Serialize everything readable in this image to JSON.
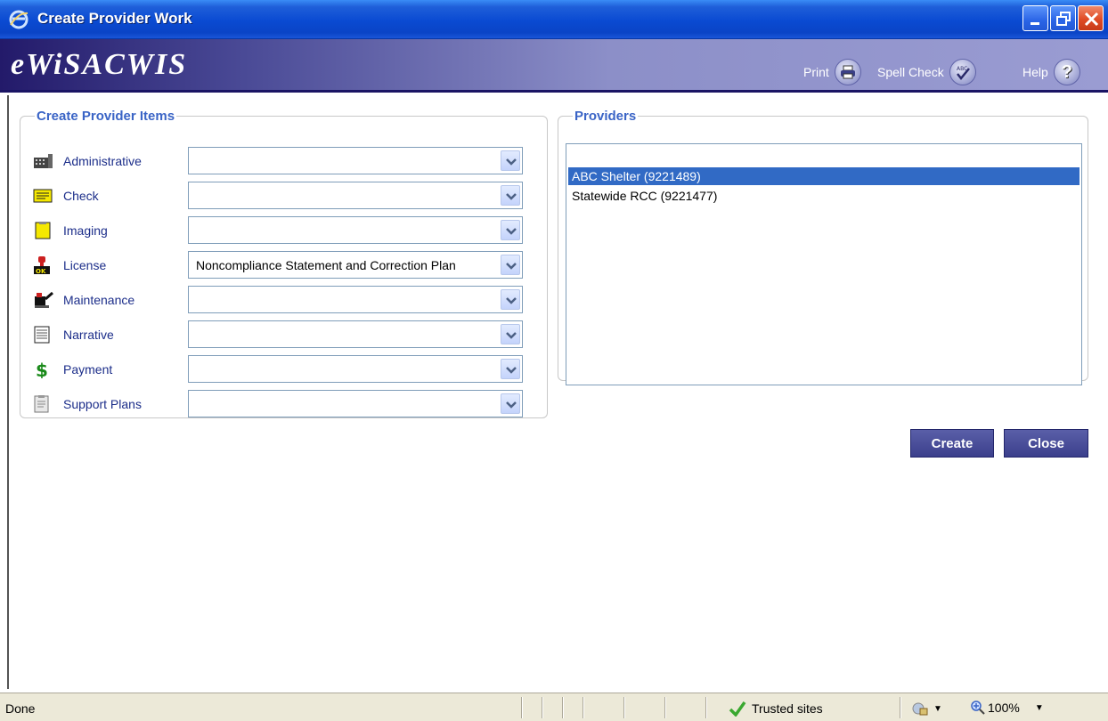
{
  "window": {
    "title": "Create Provider Work"
  },
  "banner": {
    "brand": "eWiSACWIS",
    "print_label": "Print",
    "spell_label": "Spell Check",
    "help_label": "Help"
  },
  "items_section": {
    "legend": "Create Provider Items",
    "items": [
      {
        "label": "Administrative",
        "value": "",
        "icon": "administrative-icon"
      },
      {
        "label": "Check",
        "value": "",
        "icon": "check-icon"
      },
      {
        "label": "Imaging",
        "value": "",
        "icon": "imaging-icon"
      },
      {
        "label": "License",
        "value": "Noncompliance Statement and Correction Plan",
        "icon": "license-icon"
      },
      {
        "label": "Maintenance",
        "value": "",
        "icon": "maintenance-icon"
      },
      {
        "label": "Narrative",
        "value": "",
        "icon": "narrative-icon"
      },
      {
        "label": "Payment",
        "value": "",
        "icon": "payment-icon"
      },
      {
        "label": "Support Plans",
        "value": "",
        "icon": "support-plans-icon"
      }
    ]
  },
  "providers_section": {
    "legend": "Providers",
    "providers": [
      {
        "label": "ABC Shelter (9221489)",
        "selected": true
      },
      {
        "label": "Statewide RCC (9221477)",
        "selected": false
      }
    ]
  },
  "buttons": {
    "create": "Create",
    "close": "Close"
  },
  "statusbar": {
    "status": "Done",
    "zone": "Trusted sites",
    "zoom": "100%"
  },
  "colors": {
    "legend": "#3a64c6",
    "selected_row": "#316ac5",
    "button": "#3b3f8c"
  }
}
